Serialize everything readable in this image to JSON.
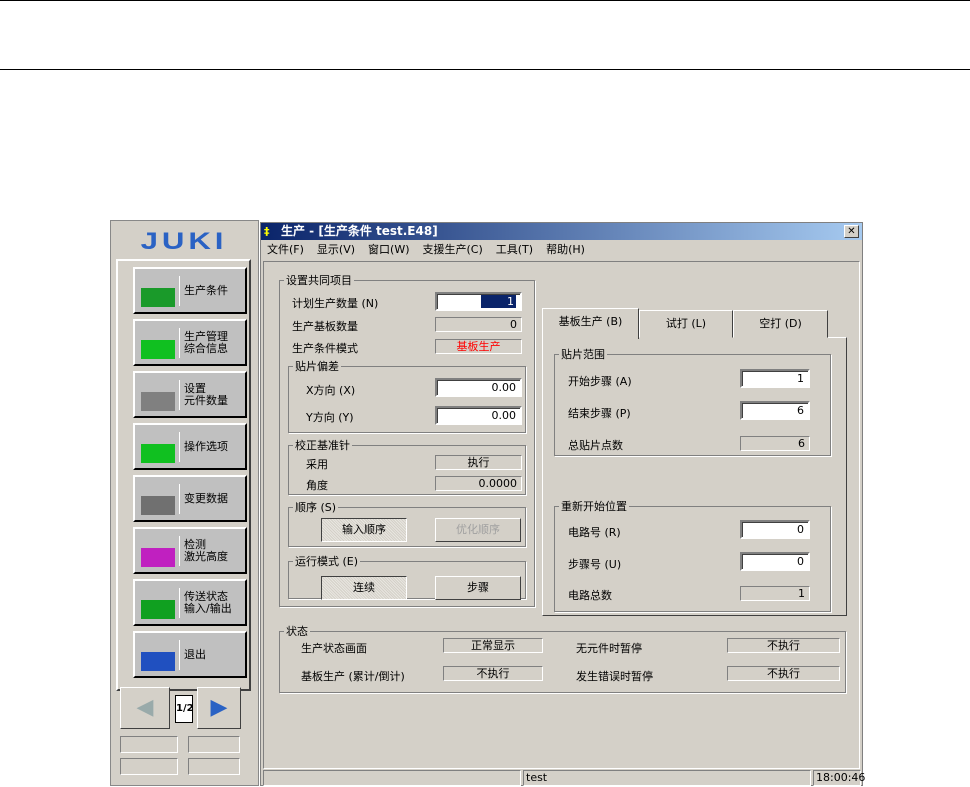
{
  "sidebar": {
    "logo": "JUKI",
    "buttons": [
      {
        "label": "生产条件",
        "icon": "pcb-hand-icon"
      },
      {
        "label": "生产管理\n综合信息",
        "icon": "nozzle-info-icon"
      },
      {
        "label": "设置\n元件数量",
        "icon": "component-count-icon"
      },
      {
        "label": "操作选项",
        "icon": "nozzle-hand-icon"
      },
      {
        "label": "变更数据",
        "icon": "edit-pen-icon"
      },
      {
        "label": "检测\n激光高度",
        "icon": "laser-height-icon"
      },
      {
        "label": "传送状态\n输入/输出",
        "icon": "conveyor-icon"
      },
      {
        "label": "退出",
        "icon": "exit-door-icon"
      }
    ],
    "page": "1/2"
  },
  "window": {
    "title": "生产 - [生产条件 test.E48]",
    "close": "✕",
    "menu": [
      "文件(F)",
      "显示(V)",
      "窗口(W)",
      "支援生产(C)",
      "工具(T)",
      "帮助(H)"
    ],
    "common": {
      "legend": "设置共同项目",
      "plan_label": "计划生产数量 (N)",
      "plan_value": "1",
      "boards_label": "生产基板数量",
      "boards_value": "0",
      "mode_label": "生产条件模式",
      "mode_value": "基板生产",
      "mode_color": "#ff0000",
      "offset": {
        "legend": "贴片偏差",
        "x_label": "X方向 (X)",
        "x_value": "0.00",
        "y_label": "Y方向 (Y)",
        "y_value": "0.00"
      },
      "pin": {
        "legend": "校正基准针",
        "use_label": "采用",
        "use_value": "执行",
        "angle_label": "角度",
        "angle_value": "0.0000"
      },
      "order": {
        "legend": "顺序 (S)",
        "input": "输入顺序",
        "optimize": "优化顺序"
      },
      "run": {
        "legend": "运行模式 (E)",
        "continuous": "连续",
        "step": "步骤"
      }
    },
    "tabs": [
      "基板生产 (B)",
      "试打 (L)",
      "空打 (D)"
    ],
    "range": {
      "legend": "贴片范围",
      "start_label": "开始步骤 (A)",
      "start_value": "1",
      "end_label": "结束步骤 (P)",
      "end_value": "6",
      "total_label": "总贴片点数",
      "total_value": "6"
    },
    "restart": {
      "legend": "重新开始位置",
      "circuit_label": "电路号 (R)",
      "circuit_value": "0",
      "step_label": "步骤号 (U)",
      "step_value": "0",
      "total_label": "电路总数",
      "total_value": "1"
    },
    "state": {
      "legend": "状态",
      "items": [
        {
          "label": "生产状态画面",
          "value": "正常显示"
        },
        {
          "label": "无元件时暂停",
          "value": "不执行"
        },
        {
          "label": "基板生产 (累计/倒计)",
          "value": "不执行"
        },
        {
          "label": "发生错误时暂停",
          "value": "不执行"
        }
      ]
    },
    "statusbar": {
      "file": "test",
      "time": "18:00:46"
    }
  }
}
